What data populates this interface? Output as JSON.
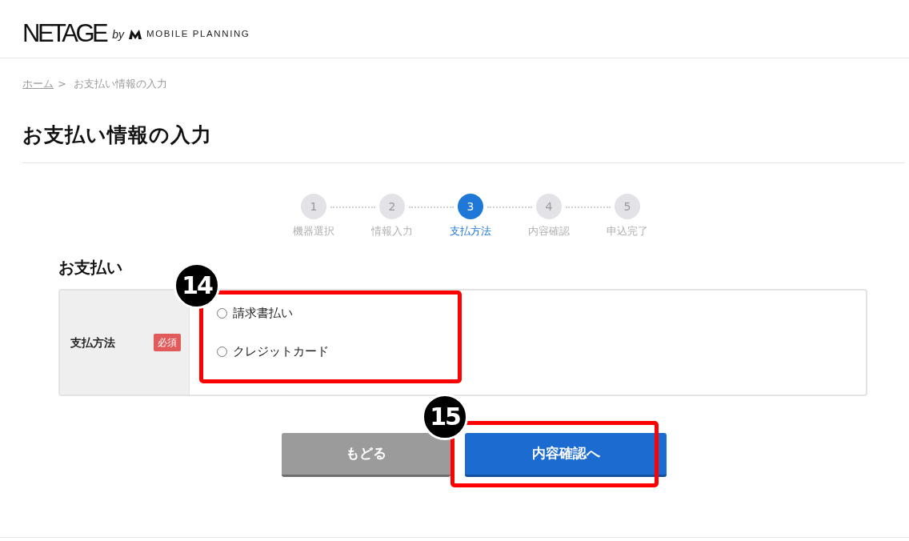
{
  "header": {
    "logo": {
      "name": "NETAGE",
      "by": "by",
      "company": "MOBILE PLANNING"
    }
  },
  "breadcrumb": {
    "items": [
      {
        "label": "ホーム",
        "link": true
      },
      {
        "label": "お支払い情報の入力",
        "link": false
      }
    ],
    "separator": ">"
  },
  "page_title": "お支払い情報の入力",
  "steps": [
    {
      "number": "1",
      "label": "機器選択",
      "selected": false
    },
    {
      "number": "2",
      "label": "情報入力",
      "selected": false
    },
    {
      "number": "3",
      "label": "支払方法",
      "selected": true
    },
    {
      "number": "4",
      "label": "内容確認",
      "selected": false
    },
    {
      "number": "5",
      "label": "申込完了",
      "selected": false
    }
  ],
  "section": {
    "title": "お支払い",
    "fields": [
      {
        "label": "支払方法",
        "badge": "必須",
        "annotation": "14",
        "options": [
          {
            "label": "請求書払い",
            "selected": false
          },
          {
            "label": "クレジットカード",
            "selected": false
          }
        ]
      }
    ]
  },
  "buttons": [
    {
      "label": "もどる",
      "kind": "secondary"
    },
    {
      "label": "内容確認へ",
      "kind": "primary",
      "annotation": "15"
    }
  ]
}
